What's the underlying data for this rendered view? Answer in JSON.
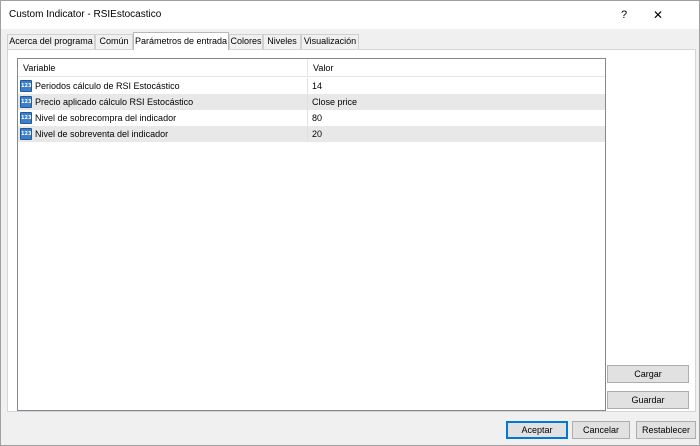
{
  "window": {
    "title": "Custom Indicator - RSIEstocastico",
    "help_label": "?",
    "close_label": "✕"
  },
  "tabs": [
    {
      "label": "Acerca del programa"
    },
    {
      "label": "Común"
    },
    {
      "label": "Parámetros de entrada"
    },
    {
      "label": "Colores"
    },
    {
      "label": "Niveles"
    },
    {
      "label": "Visualización"
    }
  ],
  "active_tab": "Parámetros de entrada",
  "grid": {
    "headers": {
      "variable": "Variable",
      "value": "Valor"
    },
    "icon_text": "123",
    "rows": [
      {
        "variable": "Periodos cálculo de RSI Estocástico",
        "value": "14"
      },
      {
        "variable": "Precio aplicado cálculo RSI Estocástico",
        "value": "Close price"
      },
      {
        "variable": "Nivel de sobrecompra del indicador",
        "value": "80"
      },
      {
        "variable": "Nivel de sobreventa del indicador",
        "value": "20"
      }
    ]
  },
  "side_buttons": {
    "load": "Cargar",
    "save": "Guardar"
  },
  "footer_buttons": {
    "ok": "Aceptar",
    "cancel": "Cancelar",
    "reset": "Restablecer"
  }
}
